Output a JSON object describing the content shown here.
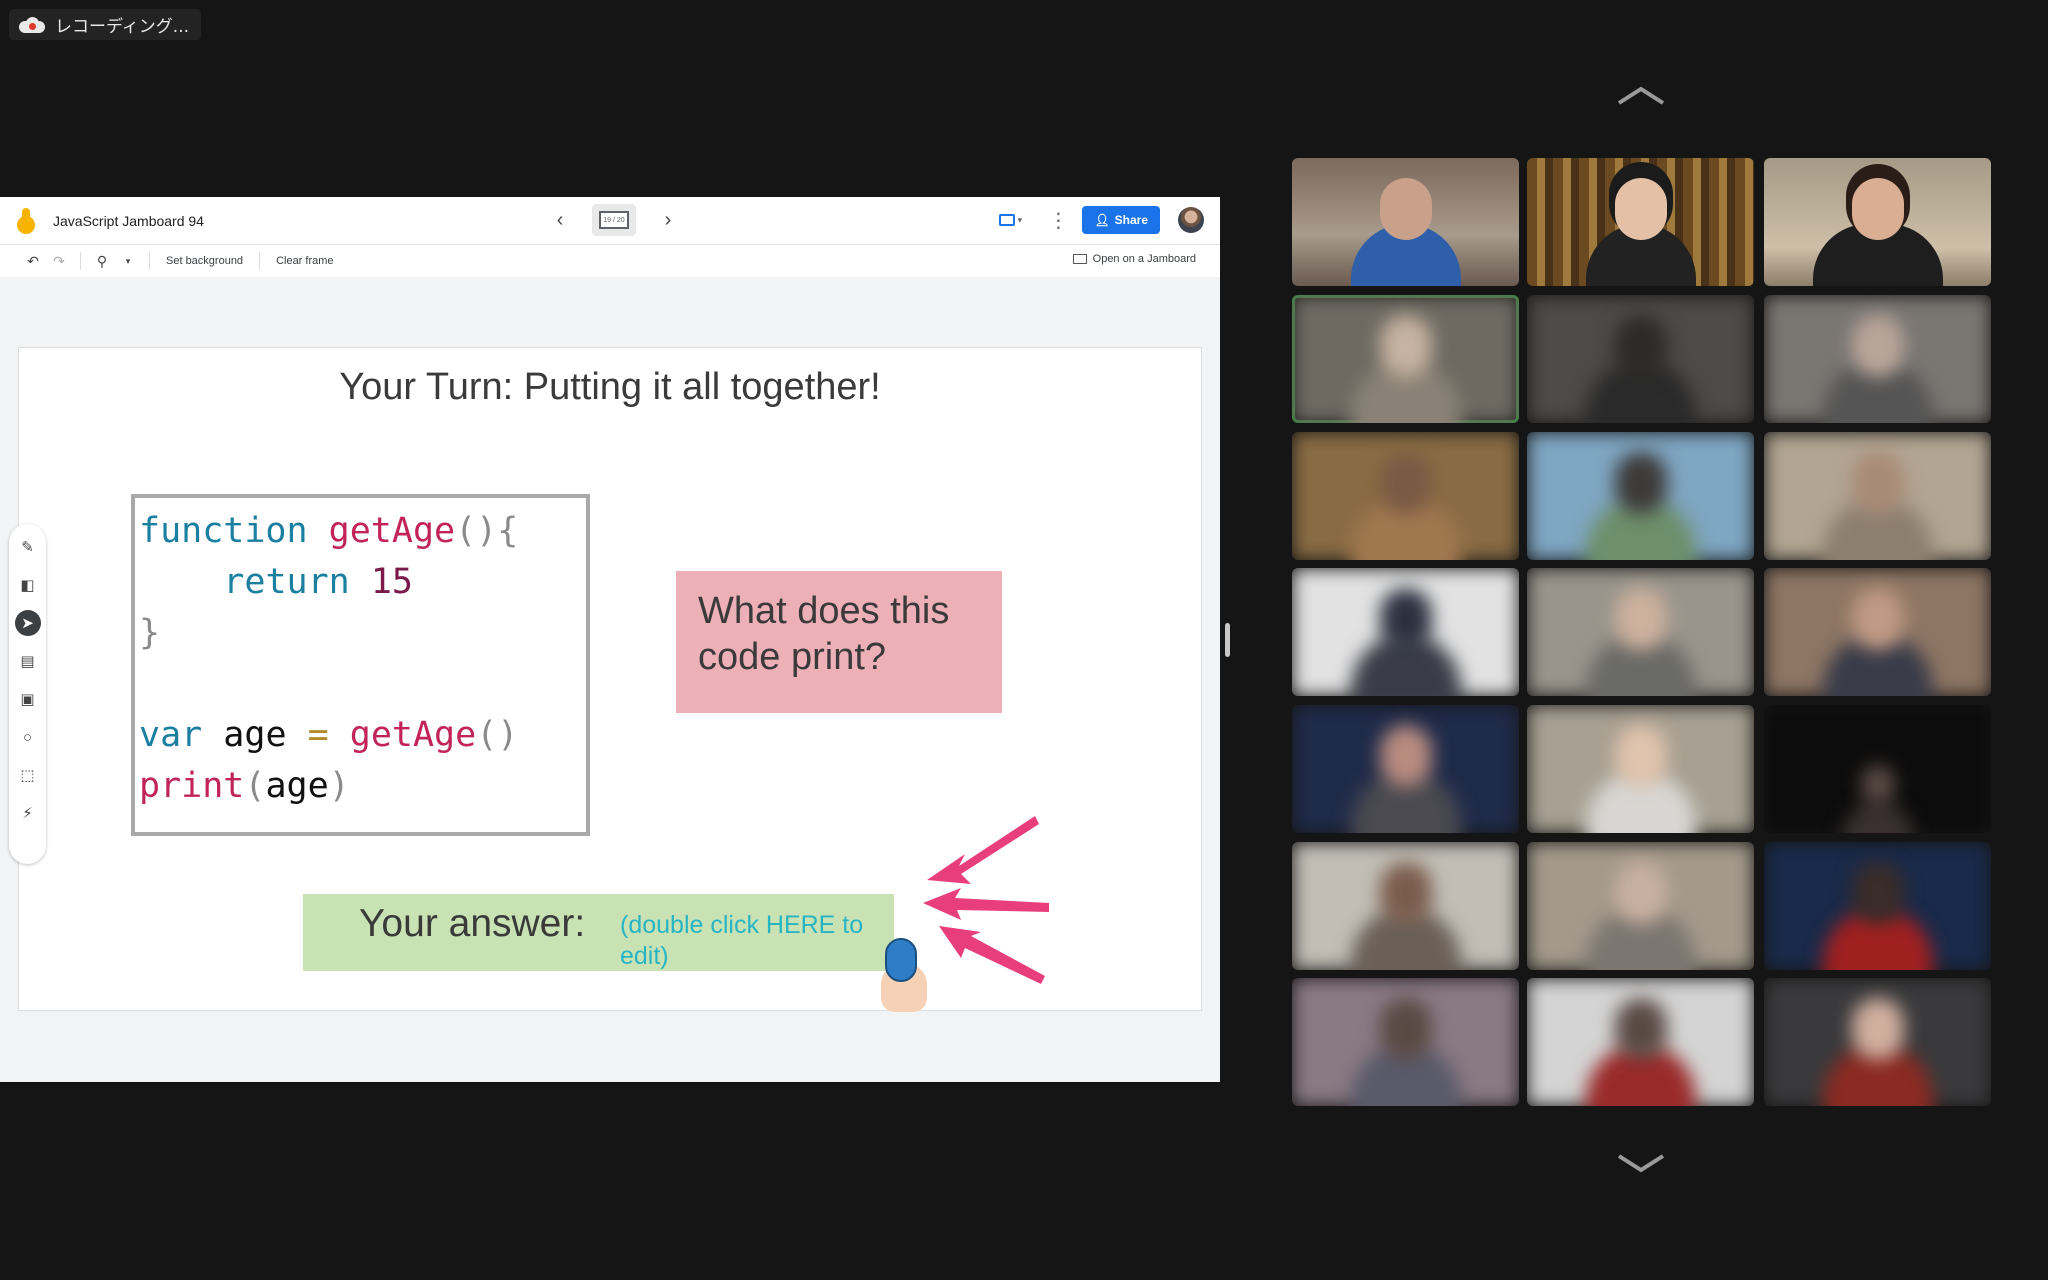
{
  "recording": {
    "label": "レコーディング..."
  },
  "jamboard": {
    "title": "JavaScript Jamboard 94",
    "frame_indicator": "19 / 20",
    "share_label": "Share",
    "toolbar": {
      "set_background": "Set background",
      "clear_frame": "Clear frame",
      "open_on_jamboard": "Open on a Jamboard"
    },
    "slide": {
      "title": "Your Turn: Putting it all together!",
      "code": {
        "l1_kw": "function",
        "l1_fn": "getAge",
        "l1_punc": "(){",
        "l2_kw": "return",
        "l2_num": "15",
        "l3_punc": "}",
        "l5_kw": "var",
        "l5_var": "age",
        "l5_op": "=",
        "l5_fn": "getAge",
        "l5_punc": "()",
        "l6_fn": "print",
        "l6_open": "(",
        "l6_var": "age",
        "l6_close": ")"
      },
      "question": "What does this code print?",
      "answer_label": "Your answer:",
      "answer_hint": "(double click HERE to edit)"
    },
    "tools": [
      "pen-icon",
      "eraser-icon",
      "select-icon",
      "sticky-note-icon",
      "image-icon",
      "shape-icon",
      "text-box-icon",
      "laser-icon"
    ]
  },
  "colors": {
    "accent": "#1a73e8",
    "sticky_pink": "#eeb0b7",
    "sticky_green": "#c8e2b4",
    "hint": "#27b5c4"
  }
}
